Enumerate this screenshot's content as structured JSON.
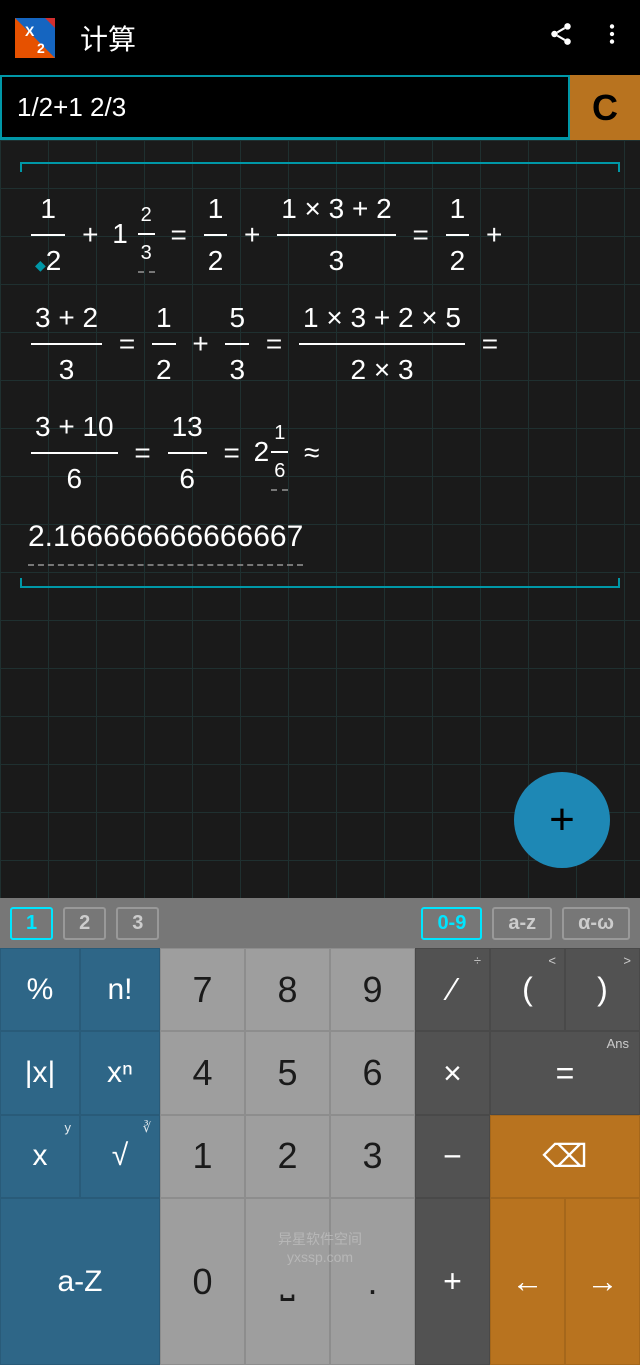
{
  "header": {
    "title": "计算"
  },
  "input": {
    "value": "1/2+1 2/3"
  },
  "clear": {
    "label": "C"
  },
  "fab": {
    "label": "+"
  },
  "tabs": {
    "left": [
      "1",
      "2",
      "3"
    ],
    "right": [
      "0-9",
      "a-z",
      "α-ω"
    ]
  },
  "keys": {
    "pct": "%",
    "fact": "n!",
    "abs": "|x|",
    "pow": "xⁿ",
    "x": "x",
    "x_sup": "y",
    "sqrt": "√",
    "sqrt_sup": "∛",
    "az": "a-Z",
    "n7": "7",
    "n8": "8",
    "n9": "9",
    "n4": "4",
    "n5": "5",
    "n6": "6",
    "n1": "1",
    "n2": "2",
    "n3": "3",
    "n0": "0",
    "dot": ".",
    "space": "⎵",
    "div": "∕",
    "div_sup": "÷",
    "mul": "×",
    "sub": "−",
    "add": "+",
    "lp": "(",
    "lp_sup": "<",
    "rp": ")",
    "rp_sup": ">",
    "eq": "=",
    "ans": "Ans",
    "bksp": "⌫",
    "left": "←",
    "right": "→"
  },
  "math": {
    "decimal": "2.166666666666667"
  },
  "watermark": {
    "l1": "异星软件空间",
    "l2": "yxssp.com"
  }
}
